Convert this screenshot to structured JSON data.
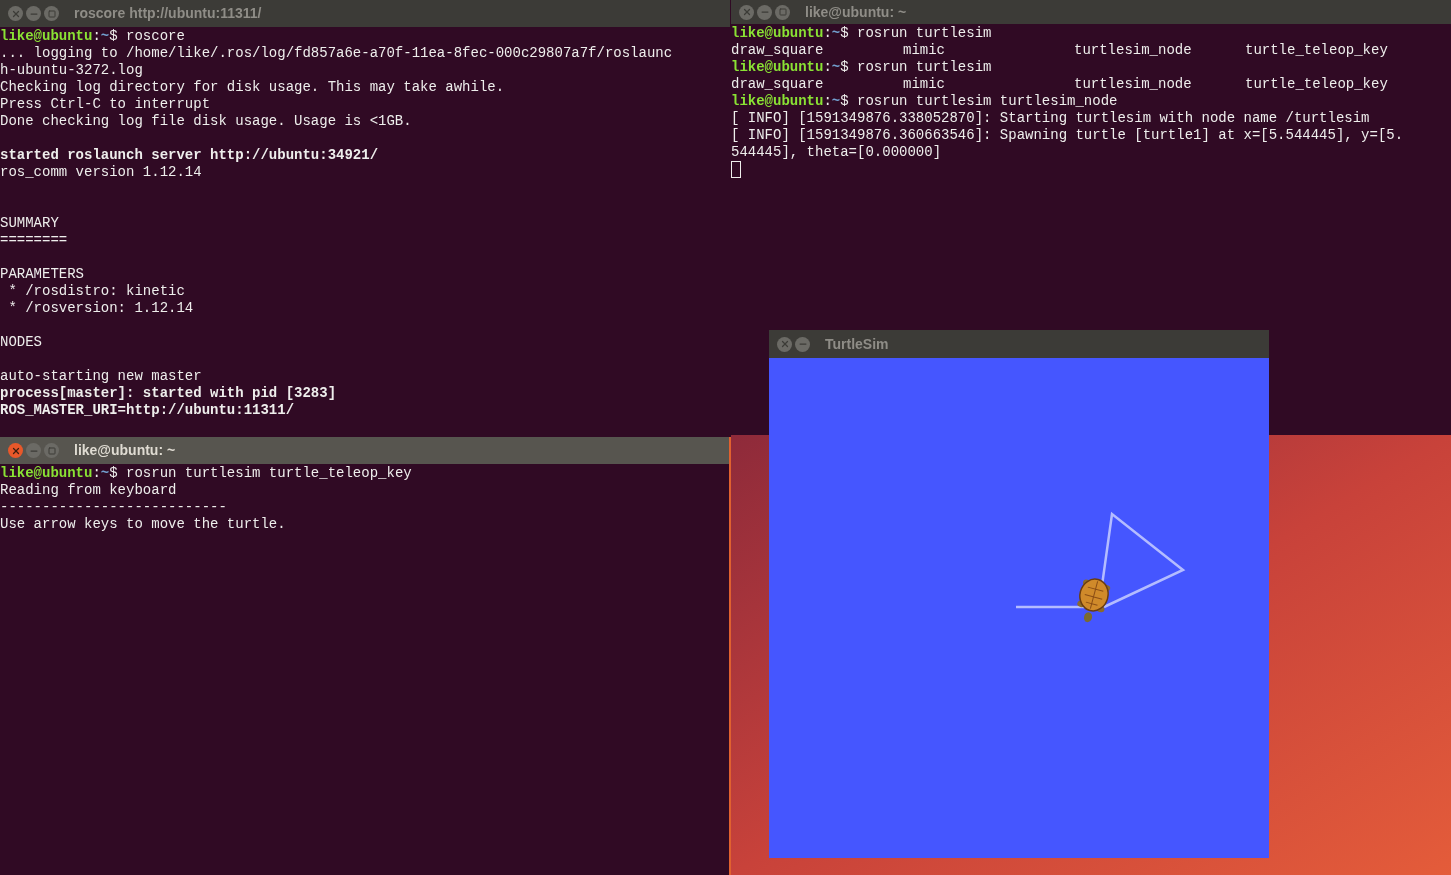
{
  "windows": [
    {
      "kind": "terminal",
      "title": "roscore http://ubuntu:11311/",
      "active": false,
      "lines": [
        {
          "kind": "prompt",
          "user": "like@ubuntu",
          "sep": ":",
          "path": "~",
          "command": "$ roscore"
        },
        {
          "kind": "text",
          "text": "... logging to /home/like/.ros/log/fd857a6e-a70f-11ea-8fec-000c29807a7f/roslaunc",
          "bold": false
        },
        {
          "kind": "text",
          "text": "h-ubuntu-3272.log",
          "bold": false
        },
        {
          "kind": "text",
          "text": "Checking log directory for disk usage. This may take awhile.",
          "bold": false
        },
        {
          "kind": "text",
          "text": "Press Ctrl-C to interrupt",
          "bold": false
        },
        {
          "kind": "text",
          "text": "Done checking log file disk usage. Usage is <1GB.",
          "bold": false
        },
        {
          "kind": "blank"
        },
        {
          "kind": "text",
          "text": "started roslaunch server http://ubuntu:34921/",
          "bold": true
        },
        {
          "kind": "text",
          "text": "ros_comm version 1.12.14",
          "bold": false
        },
        {
          "kind": "blank"
        },
        {
          "kind": "blank"
        },
        {
          "kind": "text",
          "text": "SUMMARY",
          "bold": false
        },
        {
          "kind": "text",
          "text": "========",
          "bold": false
        },
        {
          "kind": "blank"
        },
        {
          "kind": "text",
          "text": "PARAMETERS",
          "bold": false
        },
        {
          "kind": "text",
          "text": " * /rosdistro: kinetic",
          "bold": false
        },
        {
          "kind": "text",
          "text": " * /rosversion: 1.12.14",
          "bold": false
        },
        {
          "kind": "blank"
        },
        {
          "kind": "text",
          "text": "NODES",
          "bold": false
        },
        {
          "kind": "blank"
        },
        {
          "kind": "text",
          "text": "auto-starting new master",
          "bold": false
        },
        {
          "kind": "text",
          "text": "process[master]: started with pid [3283]",
          "bold": true
        },
        {
          "kind": "text",
          "text": "ROS_MASTER_URI=http://ubuntu:11311/",
          "bold": true
        }
      ]
    },
    {
      "kind": "terminal",
      "title": "like@ubuntu: ~",
      "active": false,
      "cursor": true,
      "lines": [
        {
          "kind": "prompt",
          "user": "like@ubuntu",
          "sep": ":",
          "path": "~",
          "command": "$ rosrun turtlesim "
        },
        {
          "kind": "columns",
          "cells": [
            "draw_square",
            "mimic",
            "turtlesim_node",
            "turtle_teleop_key"
          ]
        },
        {
          "kind": "prompt",
          "user": "like@ubuntu",
          "sep": ":",
          "path": "~",
          "command": "$ rosrun turtlesim "
        },
        {
          "kind": "columns",
          "cells": [
            "draw_square",
            "mimic",
            "turtlesim_node",
            "turtle_teleop_key"
          ]
        },
        {
          "kind": "prompt",
          "user": "like@ubuntu",
          "sep": ":",
          "path": "~",
          "command": "$ rosrun turtlesim turtlesim_node"
        },
        {
          "kind": "text",
          "text": "[ INFO] [1591349876.338052870]: Starting turtlesim with node name /turtlesim",
          "bold": false
        },
        {
          "kind": "text",
          "text": "[ INFO] [1591349876.360663546]: Spawning turtle [turtle1] at x=[5.544445], y=[5.",
          "bold": false
        },
        {
          "kind": "text",
          "text": "544445], theta=[0.000000]",
          "bold": false
        }
      ]
    },
    {
      "kind": "terminal",
      "title": "like@ubuntu: ~",
      "active": true,
      "lines": [
        {
          "kind": "prompt",
          "user": "like@ubuntu",
          "sep": ":",
          "path": "~",
          "command": "$ rosrun turtlesim turtle_teleop_key"
        },
        {
          "kind": "text",
          "text": "Reading from keyboard",
          "bold": false
        },
        {
          "kind": "text",
          "text": "---------------------------",
          "bold": false
        },
        {
          "kind": "text",
          "text": "Use arrow keys to move the turtle.",
          "bold": false
        }
      ]
    },
    {
      "kind": "turtlesim",
      "title": "TurtleSim",
      "active": false
    }
  ]
}
